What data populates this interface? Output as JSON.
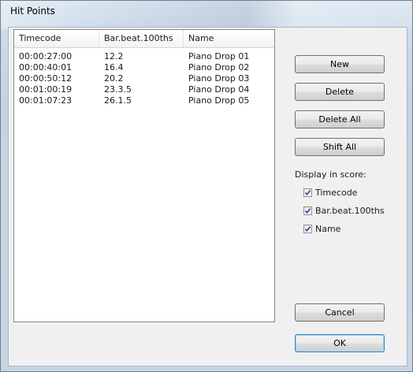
{
  "window": {
    "title": "Hit Points"
  },
  "list": {
    "columns": [
      "Timecode",
      "Bar.beat.100ths",
      "Name"
    ],
    "rows": [
      [
        "00:00:27:00",
        "12.2",
        "Piano Drop 01"
      ],
      [
        "00:00:40:01",
        "16.4",
        "Piano Drop 02"
      ],
      [
        "00:00:50:12",
        "20.2",
        "Piano Drop 03"
      ],
      [
        "00:01:00:19",
        "23.3.5",
        "Piano Drop 04"
      ],
      [
        "00:01:07:23",
        "26.1.5",
        "Piano Drop 05"
      ]
    ]
  },
  "buttons": {
    "new": "New",
    "delete": "Delete",
    "delete_all": "Delete All",
    "shift_all": "Shift All",
    "cancel": "Cancel",
    "ok": "OK"
  },
  "display": {
    "label": "Display in score:",
    "options": [
      {
        "label": "Timecode",
        "checked": true
      },
      {
        "label": "Bar.beat.100ths",
        "checked": true
      },
      {
        "label": "Name",
        "checked": true
      }
    ]
  },
  "colors": {
    "accent": "#3c7fb1",
    "list_bg": "#ffffff",
    "dialog_bg": "#f0f0f0"
  }
}
